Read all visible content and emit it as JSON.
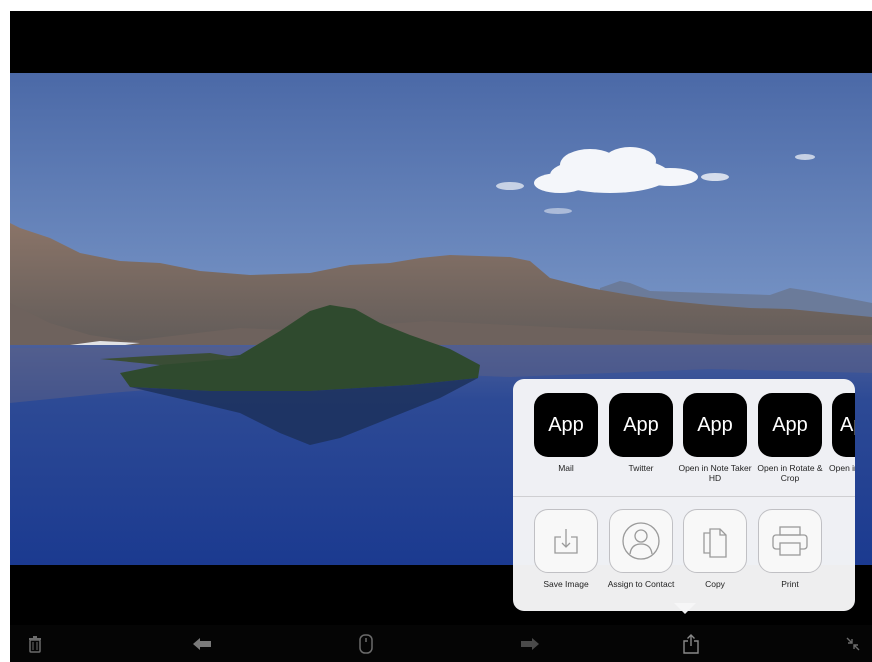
{
  "photo": {
    "description_icon": "lake-photo"
  },
  "share_sheet": {
    "apps": [
      {
        "icon_text": "App",
        "label": "Mail"
      },
      {
        "icon_text": "App",
        "label": "Twitter"
      },
      {
        "icon_text": "App",
        "label": "Open in Note Taker HD"
      },
      {
        "icon_text": "App",
        "label": "Open in Rotate & Crop"
      },
      {
        "icon_text": "App",
        "label": "Open in"
      }
    ],
    "actions": [
      {
        "icon": "save-image-icon",
        "label": "Save Image"
      },
      {
        "icon": "assign-contact-icon",
        "label": "Assign to Contact"
      },
      {
        "icon": "copy-icon",
        "label": "Copy"
      },
      {
        "icon": "print-icon",
        "label": "Print"
      }
    ]
  },
  "toolbar": {
    "items": [
      "trash-icon",
      "back-arrow-icon",
      "mouse-icon",
      "forward-arrow-icon",
      "share-icon",
      "exit-fullscreen-icon"
    ]
  },
  "colors": {
    "sky_top": "#4a6aa6",
    "water": "#22408d",
    "sheet_bg": "#f6f6f7"
  }
}
